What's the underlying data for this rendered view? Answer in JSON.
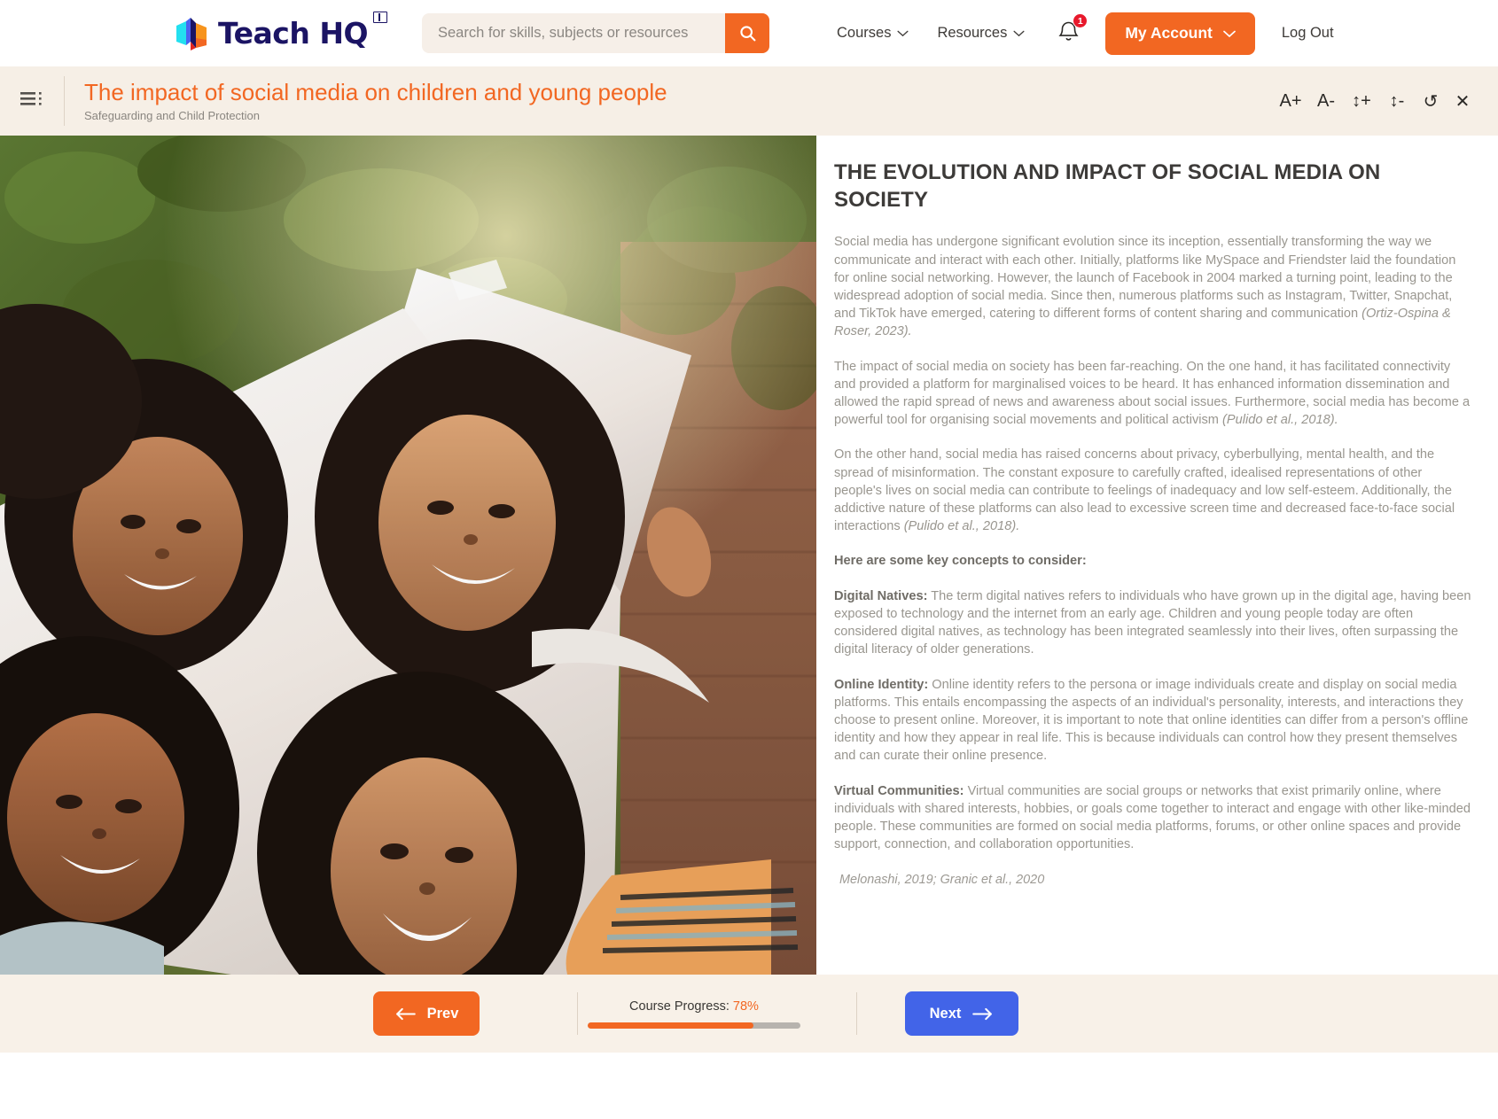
{
  "topnav": {
    "logo_text": "Teach HQ",
    "logo_mark_name": "teach-hq-logo",
    "search": {
      "placeholder": "Search for skills, subjects or resources",
      "value": "",
      "button_icon": "search-icon"
    },
    "links": [
      {
        "label": "Courses",
        "icon": "chevron-down-icon"
      },
      {
        "label": "Resources",
        "icon": "chevron-down-icon"
      }
    ],
    "notifications": {
      "icon": "bell-icon",
      "count": "1"
    },
    "account": {
      "label": "My Account",
      "icon": "chevron-down-icon"
    },
    "logout": {
      "label": "Log Out"
    }
  },
  "coursebar": {
    "menu_icon": "list-menu-icon",
    "title": "The impact of social media on children and young people",
    "subtitle": "Safeguarding and Child Protection",
    "tools": [
      {
        "name": "increase-font-size",
        "label": "A+"
      },
      {
        "name": "decrease-font-size",
        "label": "A-"
      },
      {
        "name": "increase-line-height",
        "label": "↕+"
      },
      {
        "name": "decrease-line-height",
        "label": "↕-"
      },
      {
        "name": "reset",
        "label": "↺"
      },
      {
        "name": "close",
        "label": "✕"
      }
    ]
  },
  "content": {
    "image_alt": "Four smiling young women posing together outdoors holding a large white poster board",
    "heading": "THE EVOLUTION AND IMPACT OF SOCIAL MEDIA ON SOCIETY",
    "paragraphs": [
      {
        "id": "p1",
        "text": "Social media has undergone significant evolution since its inception, essentially transforming the way we communicate and interact with each other. Initially, platforms like MySpace and Friendster laid the foundation for online social networking. However, the launch of Facebook in 2004 marked a turning point, leading to the widespread adoption of social media. Since then, numerous platforms such as Instagram, Twitter, Snapchat, and TikTok have emerged, catering to different forms of content sharing and communication ",
        "citation": "(Ortiz-Ospina & Roser, 2023)."
      },
      {
        "id": "p2",
        "text": "The impact of social media on society has been far-reaching. On the one hand, it has facilitated connectivity and provided a platform for marginalised voices to be heard. It has enhanced information dissemination and allowed the rapid spread of news and awareness about social issues. Furthermore, social media has become a powerful tool for organising social movements and political activism ",
        "citation": "(Pulido et al., 2018)."
      },
      {
        "id": "p3",
        "text": "On the other hand, social media has raised concerns about privacy, cyberbullying, mental health, and the spread of misinformation. The constant exposure to carefully crafted, idealised representations of other people's lives on social media can contribute to feelings of inadequacy and low self-esteem. Additionally, the addictive nature of these platforms can also lead to excessive screen time and decreased face-to-face social interactions ",
        "citation": "(Pulido et al., 2018)."
      }
    ],
    "key_concepts_lead": "Here are some key concepts to consider:",
    "concepts": [
      {
        "term": "Digital Natives:",
        "body": " The term digital natives refers to individuals who have grown up in the digital age, having been exposed to technology and the internet from an early age. Children and young people today are often considered digital natives, as technology has been integrated seamlessly into their lives, often surpassing the digital literacy of older generations."
      },
      {
        "term": "Online Identity:",
        "body": " Online identity refers to the persona or image individuals create and display on social media platforms. This entails encompassing the aspects of an individual's personality, interests, and interactions they choose to present online. Moreover, it is important to note that online identities can differ from a person's offline identity and how they appear in real life. This is because individuals can control how they present themselves and can curate their online presence."
      },
      {
        "term": "Virtual Communities:",
        "body": " Virtual communities are social groups or networks that exist primarily online, where individuals with shared interests, hobbies, or goals come together to interact and engage with other like-minded people. These communities are formed on social media platforms, forums, or other online spaces and provide support, connection, and collaboration opportunities."
      }
    ],
    "final_citation": "Melonashi, 2019; Granic et al., 2020"
  },
  "bottombar": {
    "prev": {
      "label": "Prev",
      "icon": "arrow-left-icon"
    },
    "progress": {
      "label": "Course Progress:",
      "value": "78%",
      "percent": 78
    },
    "next": {
      "label": "Next",
      "icon": "arrow-right-icon"
    }
  },
  "colors": {
    "brand_orange": "#f26722",
    "brand_navy": "#1b1464",
    "next_blue": "#4264e8",
    "bar_cream": "#f6efe6",
    "badge_red": "#e8192c"
  }
}
